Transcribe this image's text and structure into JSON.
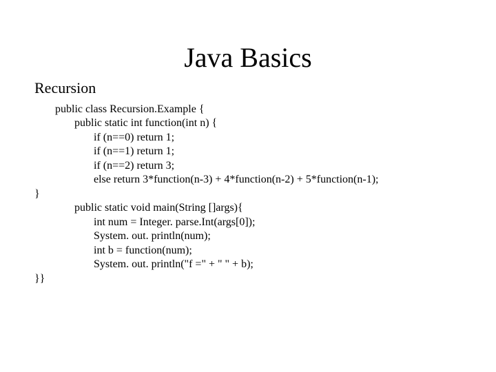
{
  "title": "Java Basics",
  "subtitle": "Recursion",
  "code": {
    "l1": "public class Recursion.Example {",
    "l2": "       public static int function(int n) {",
    "l3": "              if (n==0) return 1;",
    "l4": "              if (n==1) return 1;",
    "l5": "              if (n==2) return 3;",
    "l6": "              else return 3*function(n-3) + 4*function(n-2) + 5*function(n-1);",
    "l7": "}",
    "l8": "       public static void main(String []args){",
    "l9": "              int num = Integer. parse.Int(args[0]);",
    "l10": "              System. out. println(num);",
    "l11": "              int b = function(num);",
    "l12": "              System. out. println(\"f =\" + \" \" + b);",
    "l13": "}}"
  }
}
